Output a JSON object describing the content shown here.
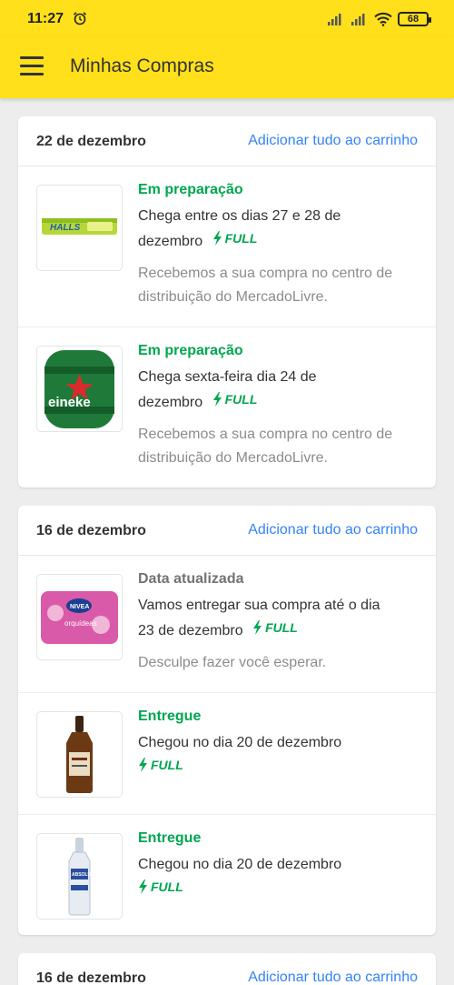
{
  "status_bar": {
    "time": "11:27",
    "battery": "68"
  },
  "app_bar": {
    "title": "Minhas Compras"
  },
  "colors": {
    "brand_yellow": "#ffe01a",
    "link_blue": "#3483fa",
    "status_green": "#00a650"
  },
  "groups": [
    {
      "date": "22 de dezembro",
      "add_all_label": "Adicionar tudo ao carrinho",
      "items": [
        {
          "image": "halls-candy",
          "status": "Em preparação",
          "line1": "Chega entre os dias 27 e 28 de",
          "line2": "dezembro",
          "full": "FULL",
          "note": "Recebemos a sua compra no centro de distribuição do MercadoLivre."
        },
        {
          "image": "heineken-keg",
          "status": "Em preparação",
          "line1": "Chega sexta-feira dia 24 de",
          "line2": "dezembro",
          "full": "FULL",
          "note": "Recebemos a sua compra no centro de distribuição do MercadoLivre."
        }
      ]
    },
    {
      "date": "16 de dezembro",
      "add_all_label": "Adicionar tudo ao carrinho",
      "items": [
        {
          "image": "nivea-wipes",
          "status": "Data atualizada",
          "line1": "Vamos entregar sua compra até o dia",
          "line2": "23 de dezembro",
          "full": "FULL",
          "note": "Desculpe fazer você esperar."
        },
        {
          "image": "ballantines-bottle",
          "status": "Entregue",
          "line1": "Chegou no dia 20 de dezembro",
          "full": "FULL"
        },
        {
          "image": "absolut-vodka-bottle",
          "status": "Entregue",
          "line1": "Chegou no dia 20 de dezembro",
          "full": "FULL"
        }
      ]
    },
    {
      "date": "16 de dezembro",
      "add_all_label": "Adicionar tudo ao carrinho"
    }
  ]
}
